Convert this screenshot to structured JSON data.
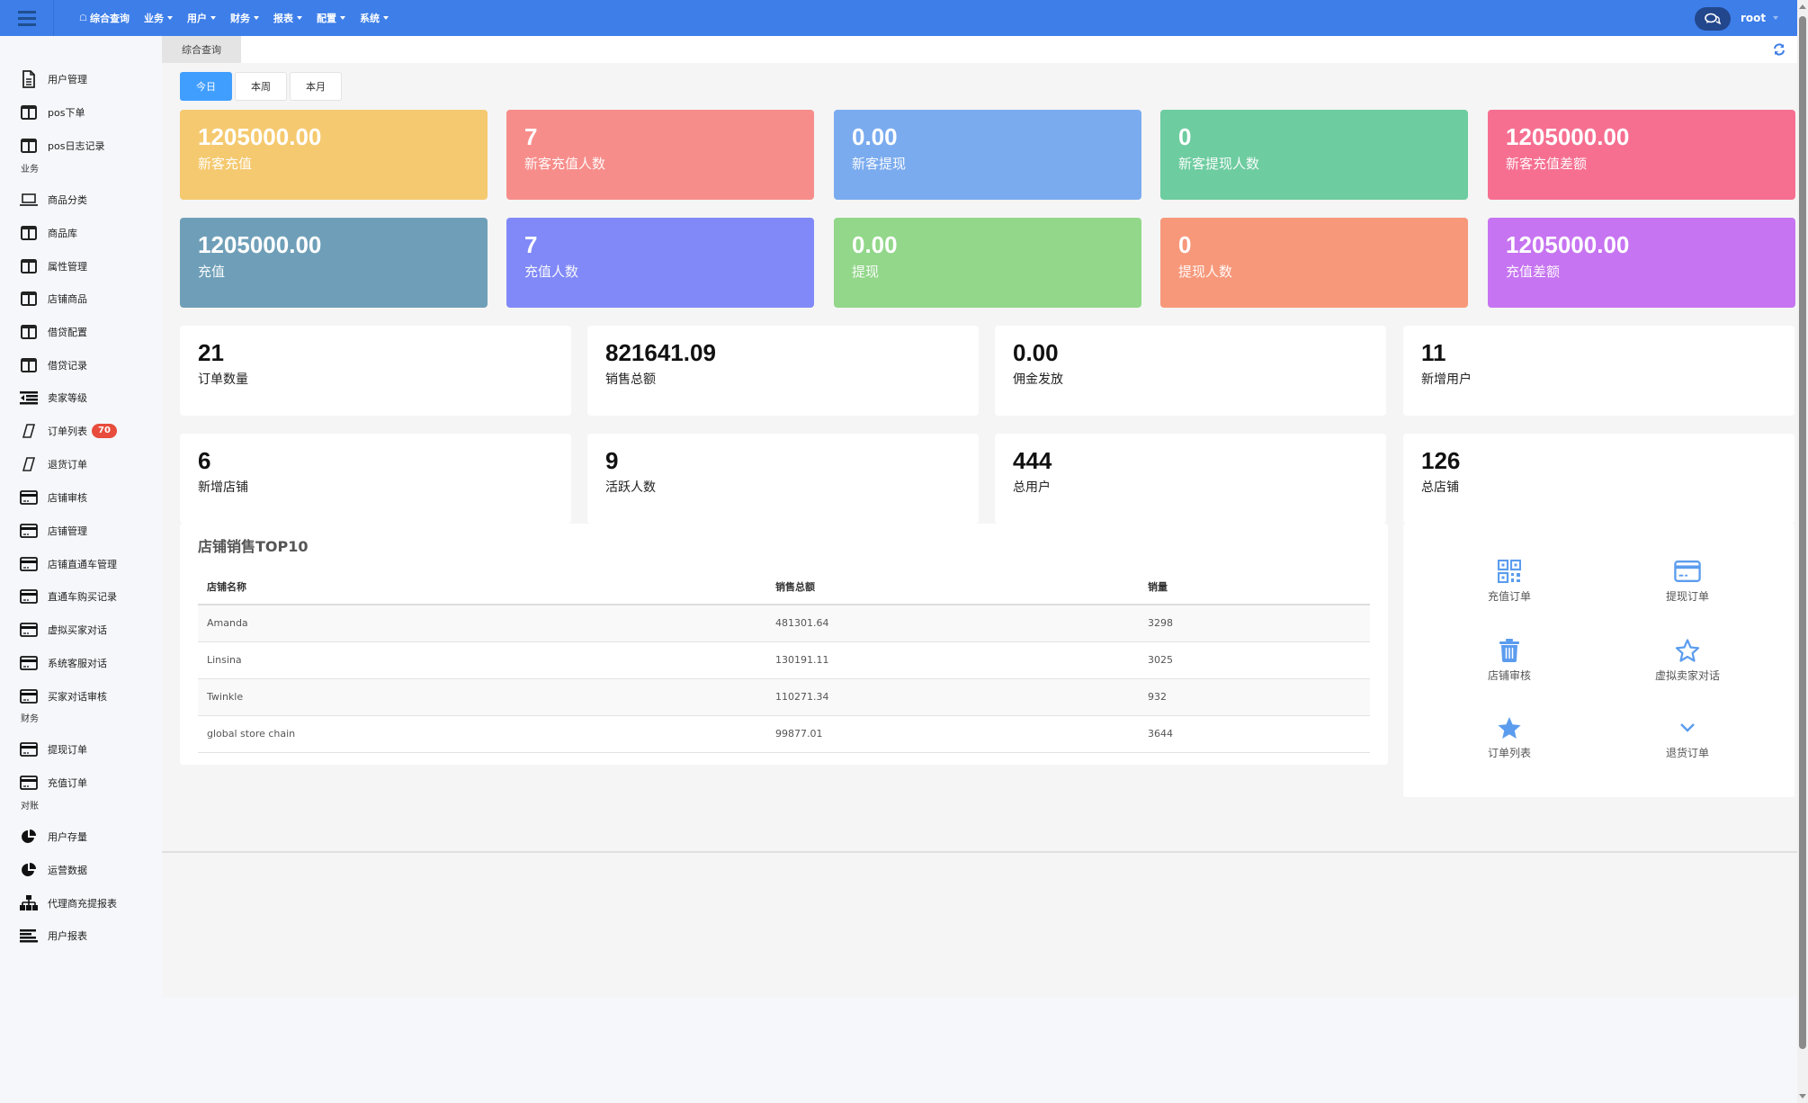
{
  "header": {
    "menu_icon": "hamburger-icon",
    "nav": [
      {
        "label": "综合查询",
        "icon": "home-icon",
        "dropdown": false
      },
      {
        "label": "业务",
        "dropdown": true
      },
      {
        "label": "用户",
        "dropdown": true
      },
      {
        "label": "财务",
        "dropdown": true
      },
      {
        "label": "报表",
        "dropdown": true
      },
      {
        "label": "配置",
        "dropdown": true
      },
      {
        "label": "系统",
        "dropdown": true
      }
    ],
    "chat_icon": "comments-icon",
    "username": "root"
  },
  "sidebar": {
    "items": [
      {
        "label": "用户管理",
        "icon": "file-text-icon"
      },
      {
        "label": "pos下单",
        "icon": "columns-icon"
      },
      {
        "label": "pos日志记录",
        "icon": "columns-icon"
      },
      {
        "section": "业务"
      },
      {
        "label": "商品分类",
        "icon": "laptop-icon"
      },
      {
        "label": "商品库",
        "icon": "columns-icon"
      },
      {
        "label": "属性管理",
        "icon": "columns-icon"
      },
      {
        "label": "店铺商品",
        "icon": "columns-icon"
      },
      {
        "label": "借贷配置",
        "icon": "columns-icon"
      },
      {
        "label": "借贷记录",
        "icon": "columns-icon"
      },
      {
        "label": "卖家等级",
        "icon": "indent-icon"
      },
      {
        "label": "订单列表",
        "icon": "parallelogram-icon",
        "badge": "70"
      },
      {
        "label": "退货订单",
        "icon": "parallelogram-icon"
      },
      {
        "label": "店铺审核",
        "icon": "credit-card-icon"
      },
      {
        "label": "店铺管理",
        "icon": "credit-card-icon"
      },
      {
        "label": "店铺直通车管理",
        "icon": "credit-card-icon"
      },
      {
        "label": "直通车购买记录",
        "icon": "credit-card-icon"
      },
      {
        "label": "虚拟买家对话",
        "icon": "credit-card-icon"
      },
      {
        "label": "系统客服对话",
        "icon": "credit-card-icon"
      },
      {
        "label": "买家对话审核",
        "icon": "credit-card-icon"
      },
      {
        "section": "财务"
      },
      {
        "label": "提现订单",
        "icon": "credit-card-icon"
      },
      {
        "label": "充值订单",
        "icon": "credit-card-icon"
      },
      {
        "section": "对账"
      },
      {
        "label": "用户存量",
        "icon": "pie-chart-icon"
      },
      {
        "label": "运营数据",
        "icon": "pie-chart-icon"
      },
      {
        "label": "代理商充提报表",
        "icon": "sitemap-icon"
      },
      {
        "label": "用户报表",
        "icon": "align-left-icon"
      }
    ]
  },
  "tabs": [
    {
      "label": "综合查询",
      "active": true
    }
  ],
  "refresh_icon": "refresh-icon",
  "range_buttons": [
    {
      "label": "今日",
      "active": true
    },
    {
      "label": "本周",
      "active": false
    },
    {
      "label": "本月",
      "active": false
    }
  ],
  "colored_cards": [
    {
      "value": "1205000.00",
      "label": "新客充值",
      "color": "#f5c96f"
    },
    {
      "value": "7",
      "label": "新客充值人数",
      "color": "#f78d8a"
    },
    {
      "value": "0.00",
      "label": "新客提现",
      "color": "#7aabef"
    },
    {
      "value": "0",
      "label": "新客提现人数",
      "color": "#6dcca0"
    },
    {
      "value": "1205000.00",
      "label": "新客充值差额",
      "color": "#f66f91"
    },
    {
      "value": "1205000.00",
      "label": "充值",
      "color": "#6f9fb8"
    },
    {
      "value": "7",
      "label": "充值人数",
      "color": "#8089f7"
    },
    {
      "value": "0.00",
      "label": "提现",
      "color": "#92d78a"
    },
    {
      "value": "0",
      "label": "提现人数",
      "color": "#f7987a"
    },
    {
      "value": "1205000.00",
      "label": "充值差额",
      "color": "#c674f1"
    }
  ],
  "white_cards": [
    {
      "value": "21",
      "label": "订单数量"
    },
    {
      "value": "821641.09",
      "label": "销售总额"
    },
    {
      "value": "0.00",
      "label": "佣金发放"
    },
    {
      "value": "11",
      "label": "新增用户"
    },
    {
      "value": "6",
      "label": "新增店铺"
    },
    {
      "value": "9",
      "label": "活跃人数"
    },
    {
      "value": "444",
      "label": "总用户"
    },
    {
      "value": "126",
      "label": "总店铺"
    }
  ],
  "top_stores": {
    "title": "店铺销售TOP10",
    "columns": [
      "店铺名称",
      "销售总额",
      "销量"
    ],
    "rows": [
      [
        "Amanda",
        "481301.64",
        "3298"
      ],
      [
        "Linsina",
        "130191.11",
        "3025"
      ],
      [
        "Twinkle",
        "110271.34",
        "932"
      ],
      [
        "global store chain",
        "99877.01",
        "3644"
      ]
    ]
  },
  "quick_links": [
    {
      "label": "充值订单",
      "icon": "qrcode-icon"
    },
    {
      "label": "提现订单",
      "icon": "credit-card-icon"
    },
    {
      "label": "店铺审核",
      "icon": "trash-icon"
    },
    {
      "label": "虚拟卖家对话",
      "icon": "star-outline-icon"
    },
    {
      "label": "订单列表",
      "icon": "star-icon"
    },
    {
      "label": "退货订单",
      "icon": "chevron-down-icon"
    }
  ],
  "accent_color": "#3d7ee9",
  "quick_icon_color": "#5b9cee"
}
